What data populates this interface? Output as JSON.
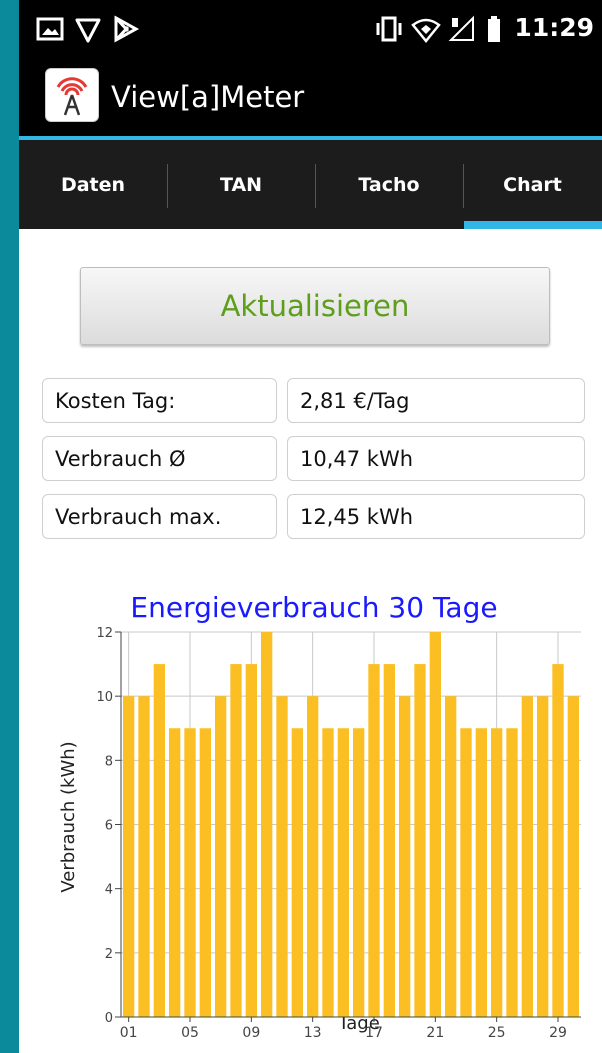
{
  "status_bar": {
    "time": "11:29",
    "icons": [
      "gallery-icon",
      "shield-icon",
      "play-store-icon",
      "vibrate-icon",
      "wifi-icon",
      "signal-icon",
      "battery-icon"
    ]
  },
  "app": {
    "title": "View[a]Meter",
    "icon": "antenna-icon"
  },
  "tabs": [
    {
      "label": "Daten",
      "selected": false
    },
    {
      "label": "TAN",
      "selected": false
    },
    {
      "label": "Tacho",
      "selected": false
    },
    {
      "label": "Chart",
      "selected": true
    }
  ],
  "refresh_button": {
    "label": "Aktualisieren"
  },
  "stats": [
    {
      "label": "Kosten Tag:",
      "value": "2,81 €/Tag"
    },
    {
      "label": "Verbrauch Ø",
      "value": "10,47 kWh"
    },
    {
      "label": "Verbrauch max.",
      "value": "12,45 kWh"
    }
  ],
  "colors": {
    "accent": "#33b5e5",
    "bar": "#fbbf24",
    "title": "#1a1aff",
    "button_text": "#5e9e1d"
  },
  "chart_data": {
    "type": "bar",
    "title": "Energieverbrauch 30 Tage",
    "xlabel": "Tage",
    "ylabel": "Verbrauch (kWh)",
    "ylim": [
      0,
      12
    ],
    "yticks": [
      "0",
      "2",
      "4",
      "6",
      "8",
      "10",
      "12"
    ],
    "xtick_labels": [
      "01",
      "05",
      "09",
      "13",
      "17",
      "21",
      "25",
      "29"
    ],
    "categories": [
      "01",
      "02",
      "03",
      "04",
      "05",
      "06",
      "07",
      "08",
      "09",
      "10",
      "11",
      "12",
      "13",
      "14",
      "15",
      "16",
      "17",
      "18",
      "19",
      "20",
      "21",
      "22",
      "23",
      "24",
      "25",
      "26",
      "27",
      "28",
      "29",
      "30"
    ],
    "values": [
      10,
      10,
      11,
      9,
      9,
      9,
      10,
      11,
      11,
      12,
      10,
      9,
      10,
      9,
      9,
      9,
      11,
      11,
      10,
      11,
      12,
      10,
      9,
      9,
      9,
      9,
      10,
      10,
      11,
      10
    ],
    "grid": true
  }
}
